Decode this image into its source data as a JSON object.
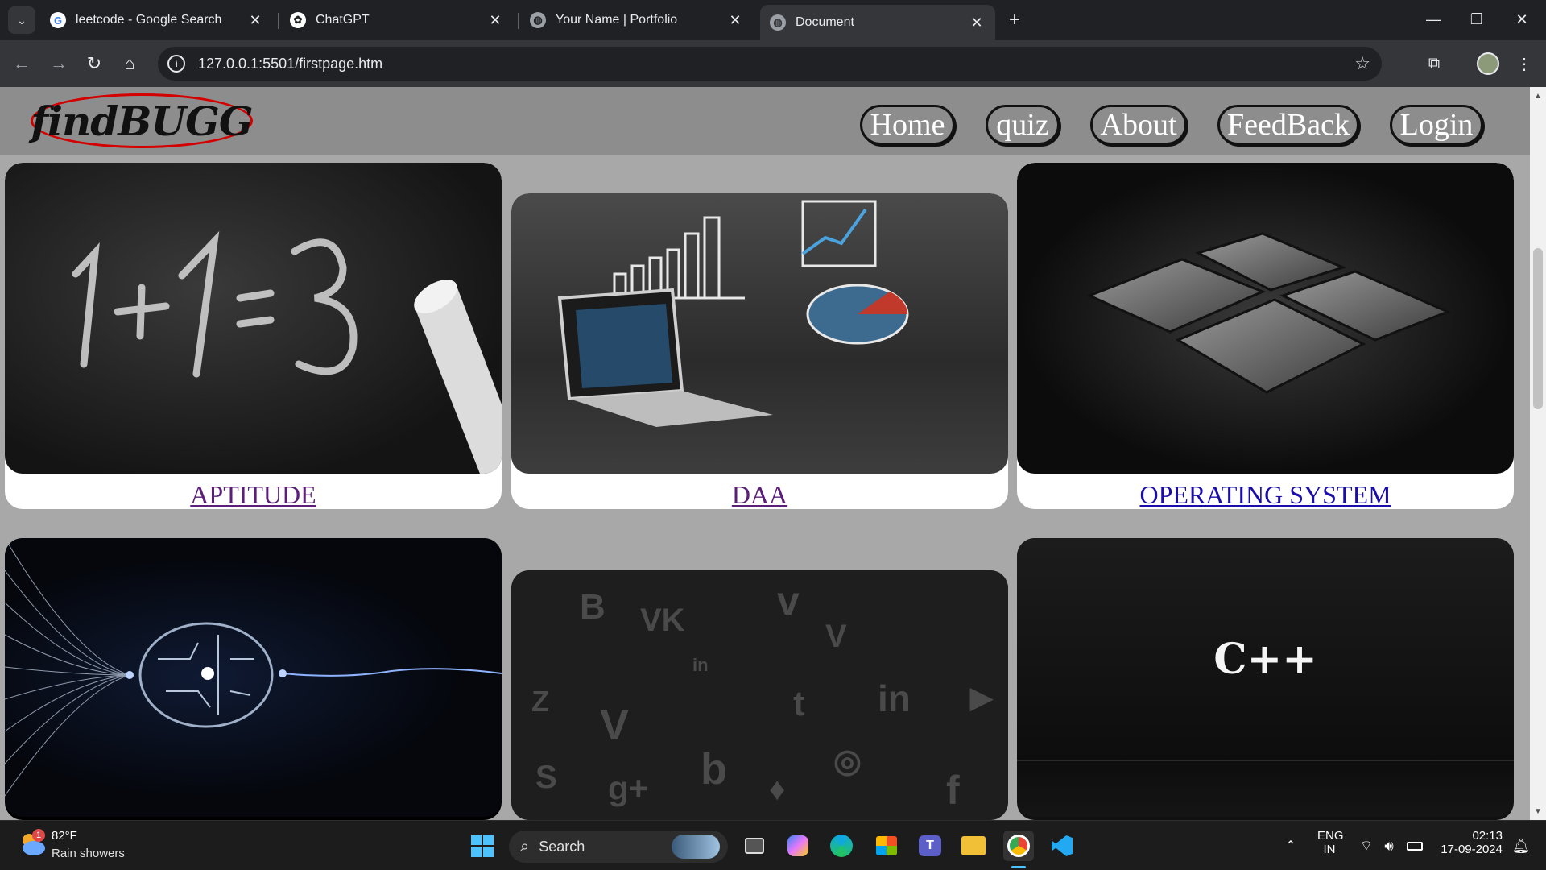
{
  "browser": {
    "tabs": [
      {
        "title": "leetcode - Google Search",
        "favicon": "google-icon",
        "active": false
      },
      {
        "title": "ChatGPT",
        "favicon": "chatgpt-icon",
        "active": false
      },
      {
        "title": "Your Name | Portfolio",
        "favicon": "globe-icon",
        "active": false
      },
      {
        "title": "Document",
        "favicon": "globe-icon",
        "active": true
      }
    ],
    "url": "127.0.0.1:5501/firstpage.htm"
  },
  "site": {
    "logo": "findBUGG",
    "nav": [
      "Home",
      "quiz",
      "About",
      "FeedBack",
      "Login"
    ],
    "cards": [
      {
        "label": "APTITUDE",
        "image": "chalkboard-1+1=3",
        "link_color": "#5b1f7a"
      },
      {
        "label": "DAA",
        "image": "laptop-charts",
        "link_color": "#5b1f7a"
      },
      {
        "label": "OPERATING SYSTEM",
        "image": "windows-logo",
        "link_color": "#1a0dab"
      },
      {
        "label": "",
        "image": "ai-brain-circuit"
      },
      {
        "label": "",
        "image": "social-media-icons"
      },
      {
        "label": "",
        "image": "cpp-dark",
        "image_text": "C++"
      }
    ]
  },
  "taskbar": {
    "weather": {
      "temp": "82°F",
      "desc": "Rain showers",
      "badge": "1"
    },
    "search_label": "Search",
    "tray": {
      "lang1": "ENG",
      "lang2": "IN",
      "time": "02:13",
      "date": "17-09-2024"
    }
  }
}
